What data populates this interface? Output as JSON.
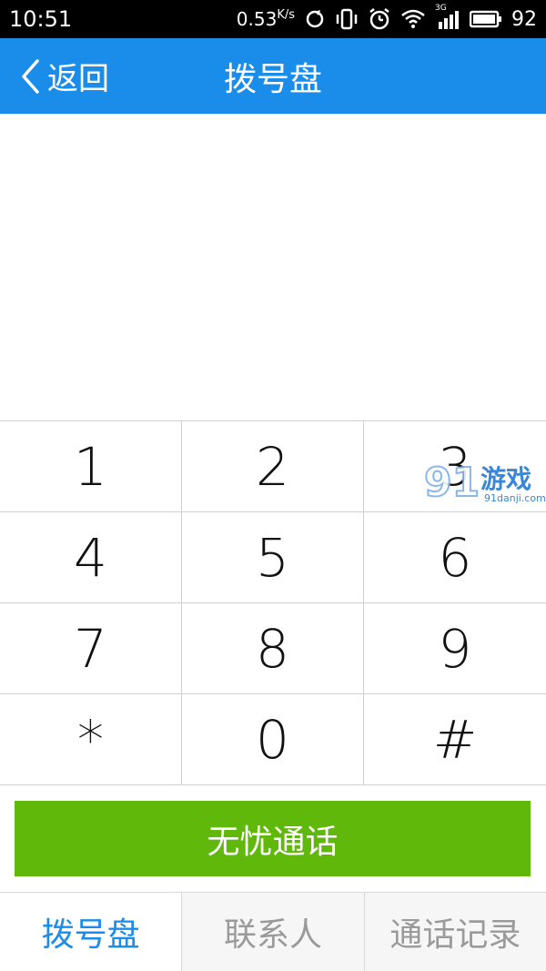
{
  "status_bar": {
    "time": "10:51",
    "net_speed": "0.53",
    "net_speed_unit": "K/s",
    "signal_label": "3G",
    "battery": "92"
  },
  "header": {
    "back_label": "返回",
    "title": "拨号盘"
  },
  "dialed_number": "",
  "keypad": {
    "keys": [
      "1",
      "2",
      "3",
      "4",
      "5",
      "6",
      "7",
      "8",
      "9",
      "*",
      "0",
      "#"
    ]
  },
  "watermark": {
    "text": "游戏",
    "site": "91danji.com"
  },
  "call_button": {
    "label": "无忧通话"
  },
  "tabs": [
    {
      "label": "拨号盘",
      "active": true
    },
    {
      "label": "联系人",
      "active": false
    },
    {
      "label": "通话记录",
      "active": false
    }
  ],
  "colors": {
    "header_blue": "#1a8ce9",
    "call_green": "#5fb80a",
    "tab_active": "#1a8ce9",
    "tab_inactive": "#9a9a9a"
  }
}
